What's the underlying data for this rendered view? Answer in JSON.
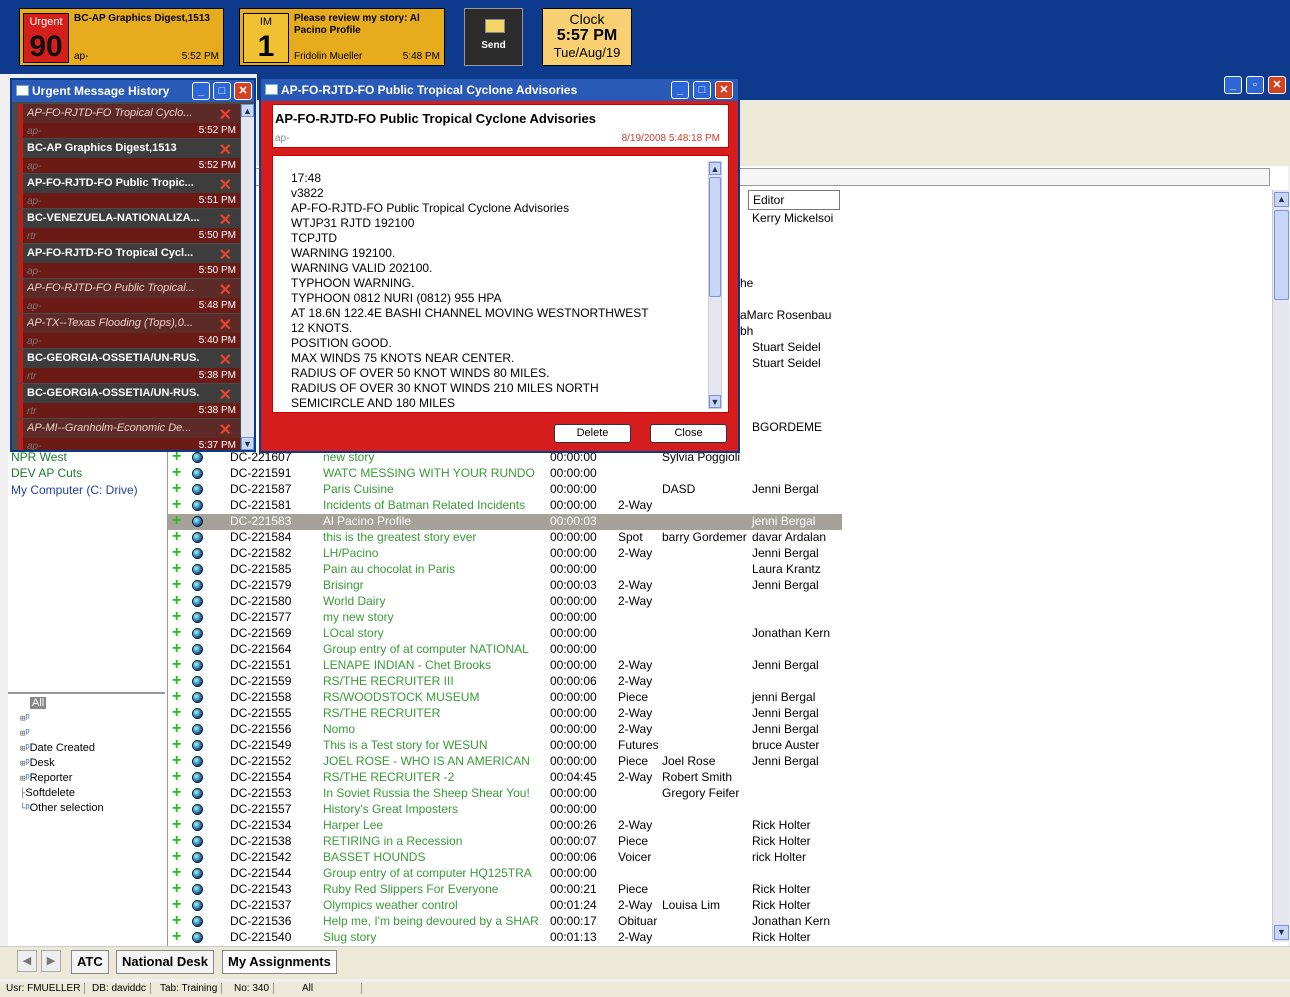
{
  "topbar": {
    "urgent": {
      "label": "Urgent",
      "count": "90",
      "title": "BC-AP Graphics Digest,1513",
      "source": "ap-",
      "time": "5:52 PM"
    },
    "im": {
      "label": "IM",
      "count": "1",
      "title": "Please review my story: Al Pacino Profile",
      "sender": "Fridolin Mueller",
      "time": "5:48 PM"
    },
    "send": {
      "label": "Send"
    },
    "clock": {
      "label": "Clock",
      "time": "5:57 PM",
      "date": "Tue/Aug/19"
    }
  },
  "urgent_panel": {
    "title": "Urgent Message History",
    "items": [
      {
        "headline": "AP-FO-RJTD-FO Tropical Cyclo...",
        "source": "ap-",
        "time": "5:52 PM",
        "read": true
      },
      {
        "headline": "BC-AP Graphics Digest,1513",
        "source": "ap-",
        "time": "5:52 PM",
        "read": false
      },
      {
        "headline": "AP-FO-RJTD-FO Public Tropic...",
        "source": "ap-",
        "time": "5:51 PM",
        "read": false
      },
      {
        "headline": "BC-VENEZUELA-NATIONALIZA...",
        "source": "rtr",
        "time": "5:50 PM",
        "read": false
      },
      {
        "headline": "AP-FO-RJTD-FO Tropical Cycl...",
        "source": "ap-",
        "time": "5:50 PM",
        "read": false
      },
      {
        "headline": "AP-FO-RJTD-FO Public Tropical...",
        "source": "ap-",
        "time": "5:48 PM",
        "read": true
      },
      {
        "headline": "AP-TX--Texas Flooding (Tops),0...",
        "source": "ap-",
        "time": "5:40 PM",
        "read": true
      },
      {
        "headline": "BC-GEORGIA-OSSETIA/UN-RUS...",
        "source": "rtr",
        "time": "5:38 PM",
        "read": false
      },
      {
        "headline": "BC-GEORGIA-OSSETIA/UN-RUS...",
        "source": "rtr",
        "time": "5:38 PM",
        "read": false
      },
      {
        "headline": "AP-MI--Granholm-Economic De...",
        "source": "ap-",
        "time": "5:37 PM",
        "read": true
      }
    ]
  },
  "advisory": {
    "window_title": "AP-FO-RJTD-FO Public Tropical Cyclone Advisories",
    "headline": "AP-FO-RJTD-FO Public Tropical Cyclone Advisories",
    "source": "ap-",
    "datetime": "8/19/2008 5:48:18 PM",
    "body": [
      "17:48",
      "v3822",
      "AP-FO-RJTD-FO Public Tropical Cyclone Advisories",
      "WTJP31 RJTD 192100",
      "TCPJTD",
      "WARNING 192100.",
      "WARNING VALID 202100.",
      "TYPHOON WARNING.",
      "TYPHOON 0812 NURI (0812) 955 HPA",
      "AT 18.6N 122.4E BASHI CHANNEL MOVING WESTNORTHWEST",
      "12 KNOTS.",
      "POSITION GOOD.",
      "MAX WINDS 75 KNOTS NEAR CENTER.",
      "RADIUS OF OVER 50 KNOT WINDS 80 MILES.",
      "RADIUS OF OVER 30 KNOT WINDS 210 MILES NORTH",
      "SEMICIRCLE AND 180 MILES"
    ],
    "delete_label": "Delete",
    "close_label": "Close"
  },
  "grid": {
    "editor_header": "Editor",
    "background_editors": [
      "Kerry Mickelsoi",
      "he",
      "aMarc Rosenbau",
      "bh",
      "Stuart Seidel",
      "Stuart Seidel",
      "BGORDEME"
    ],
    "rows": [
      {
        "id": "DC-221607",
        "title": "new story",
        "dur": "00:00:00",
        "type": "",
        "reporter": "Sylvia Poggioli",
        "editor": ""
      },
      {
        "id": "DC-221591",
        "title": "WATC MESSING WITH YOUR RUNDO",
        "dur": "00:00:00",
        "type": "",
        "reporter": "",
        "editor": ""
      },
      {
        "id": "DC-221587",
        "title": "Paris Cuisine",
        "dur": "00:00:00",
        "type": "",
        "reporter": "DASD",
        "editor": "Jenni Bergal"
      },
      {
        "id": "DC-221581",
        "title": "Incidents of Batman Related Incidents",
        "dur": "00:00:00",
        "type": "2-Way",
        "reporter": "",
        "editor": ""
      },
      {
        "id": "DC-221583",
        "title": "Al Pacino Profile",
        "dur": "00:00:03",
        "type": "",
        "reporter": "",
        "editor": "jenni Bergal",
        "selected": true
      },
      {
        "id": "DC-221584",
        "title": "this is the greatest story ever",
        "dur": "00:00:00",
        "type": "Spot",
        "reporter": "barry Gordemer",
        "editor": "davar Ardalan"
      },
      {
        "id": "DC-221582",
        "title": "LH/Pacino",
        "dur": "00:00:00",
        "type": "2-Way",
        "reporter": "",
        "editor": "Jenni Bergal"
      },
      {
        "id": "DC-221585",
        "title": "Pain au chocolat in Paris",
        "dur": "00:00:00",
        "type": "",
        "reporter": "",
        "editor": "Laura Krantz"
      },
      {
        "id": "DC-221579",
        "title": "Brisingr",
        "dur": "00:00:03",
        "type": "2-Way",
        "reporter": "",
        "editor": "Jenni Bergal"
      },
      {
        "id": "DC-221580",
        "title": "World Dairy",
        "dur": "00:00:00",
        "type": "2-Way",
        "reporter": "",
        "editor": ""
      },
      {
        "id": "DC-221577",
        "title": "my new story",
        "dur": "00:00:00",
        "type": "",
        "reporter": "",
        "editor": ""
      },
      {
        "id": "DC-221569",
        "title": "LOcal story",
        "dur": "00:00:00",
        "type": "",
        "reporter": "",
        "editor": "Jonathan Kern"
      },
      {
        "id": "DC-221564",
        "title": "Group entry of  at computer NATIONAL",
        "dur": "00:00:00",
        "type": "",
        "reporter": "",
        "editor": ""
      },
      {
        "id": "DC-221551",
        "title": "LENAPE INDIAN - Chet Brooks",
        "dur": "00:00:00",
        "type": "2-Way",
        "reporter": "",
        "editor": "Jenni Bergal"
      },
      {
        "id": "DC-221559",
        "title": "RS/THE RECRUITER III",
        "dur": "00:00:06",
        "type": "2-Way",
        "reporter": "",
        "editor": ""
      },
      {
        "id": "DC-221558",
        "title": "RS/WOODSTOCK MUSEUM",
        "dur": "00:00:00",
        "type": "Piece",
        "reporter": "",
        "editor": "jenni Bergal"
      },
      {
        "id": "DC-221555",
        "title": "RS/THE RECRUITER",
        "dur": "00:00:00",
        "type": "2-Way",
        "reporter": "",
        "editor": "Jenni Bergal"
      },
      {
        "id": "DC-221556",
        "title": "Nomo",
        "dur": "00:00:00",
        "type": "2-Way",
        "reporter": "",
        "editor": "Jenni Bergal"
      },
      {
        "id": "DC-221549",
        "title": "This is a Test story for WESUN",
        "dur": "00:00:00",
        "type": "Futures",
        "reporter": "",
        "editor": "bruce Auster"
      },
      {
        "id": "DC-221552",
        "title": "JOEL ROSE - WHO IS AN AMERICAN",
        "dur": "00:00:00",
        "type": "Piece",
        "reporter": "Joel Rose",
        "editor": "Jenni Bergal"
      },
      {
        "id": "DC-221554",
        "title": "RS/THE RECRUITER -2",
        "dur": "00:04:45",
        "type": "2-Way",
        "reporter": "Robert Smith",
        "editor": ""
      },
      {
        "id": "DC-221553",
        "title": "In Soviet Russia the Sheep Shear You!",
        "dur": "00:00:00",
        "type": "",
        "reporter": "Gregory Feifer",
        "editor": ""
      },
      {
        "id": "DC-221557",
        "title": "History's Great Imposters",
        "dur": "00:00:00",
        "type": "",
        "reporter": "",
        "editor": ""
      },
      {
        "id": "DC-221534",
        "title": "Harper Lee",
        "dur": "00:00:26",
        "type": "2-Way",
        "reporter": "",
        "editor": "Rick Holter"
      },
      {
        "id": "DC-221538",
        "title": "RETIRING in a Recession",
        "dur": "00:00:07",
        "type": "Piece",
        "reporter": "",
        "editor": "Rick Holter"
      },
      {
        "id": "DC-221542",
        "title": "BASSET HOUNDS",
        "dur": "00:00:06",
        "type": "Voicer",
        "reporter": "",
        "editor": "rick Holter"
      },
      {
        "id": "DC-221544",
        "title": "Group entry of  at computer HQ125TRA",
        "dur": "00:00:00",
        "type": "",
        "reporter": "",
        "editor": ""
      },
      {
        "id": "DC-221543",
        "title": "Ruby Red Slippers For Everyone",
        "dur": "00:00:21",
        "type": "Piece",
        "reporter": "",
        "editor": "Rick Holter"
      },
      {
        "id": "DC-221537",
        "title": "Olympics weather control",
        "dur": "00:01:24",
        "type": "2-Way",
        "reporter": "Louisa Lim",
        "editor": "Rick Holter"
      },
      {
        "id": "DC-221536",
        "title": "Help me, I'm being devoured by a SHAR",
        "dur": "00:00:17",
        "type": "Obituar",
        "reporter": "",
        "editor": "Jonathan Kern"
      },
      {
        "id": "DC-221540",
        "title": "Slug story",
        "dur": "00:01:13",
        "type": "2-Way",
        "reporter": "",
        "editor": "Rick Holter"
      }
    ]
  },
  "folders": [
    "NPR West",
    "DEV AP Cuts",
    "My Computer (C: Drive)"
  ],
  "tree": {
    "root": "All",
    "nodes": [
      "",
      "",
      "Date Created",
      "Desk",
      "Reporter",
      "Softdelete",
      "Other selection"
    ]
  },
  "tabs": [
    "ATC",
    "National Desk",
    "My Assignments"
  ],
  "status": {
    "user": "Usr: FMUELLER",
    "db": "DB: daviddc",
    "tab": "Tab: Training",
    "no": "No: 340",
    "filter": "All"
  },
  "colors": {
    "title_bar": "#0d3a8c",
    "advisory_bg": "#d61d1d",
    "story_text": "#3a9a3a",
    "tile_gold": "#e6ac1d"
  }
}
